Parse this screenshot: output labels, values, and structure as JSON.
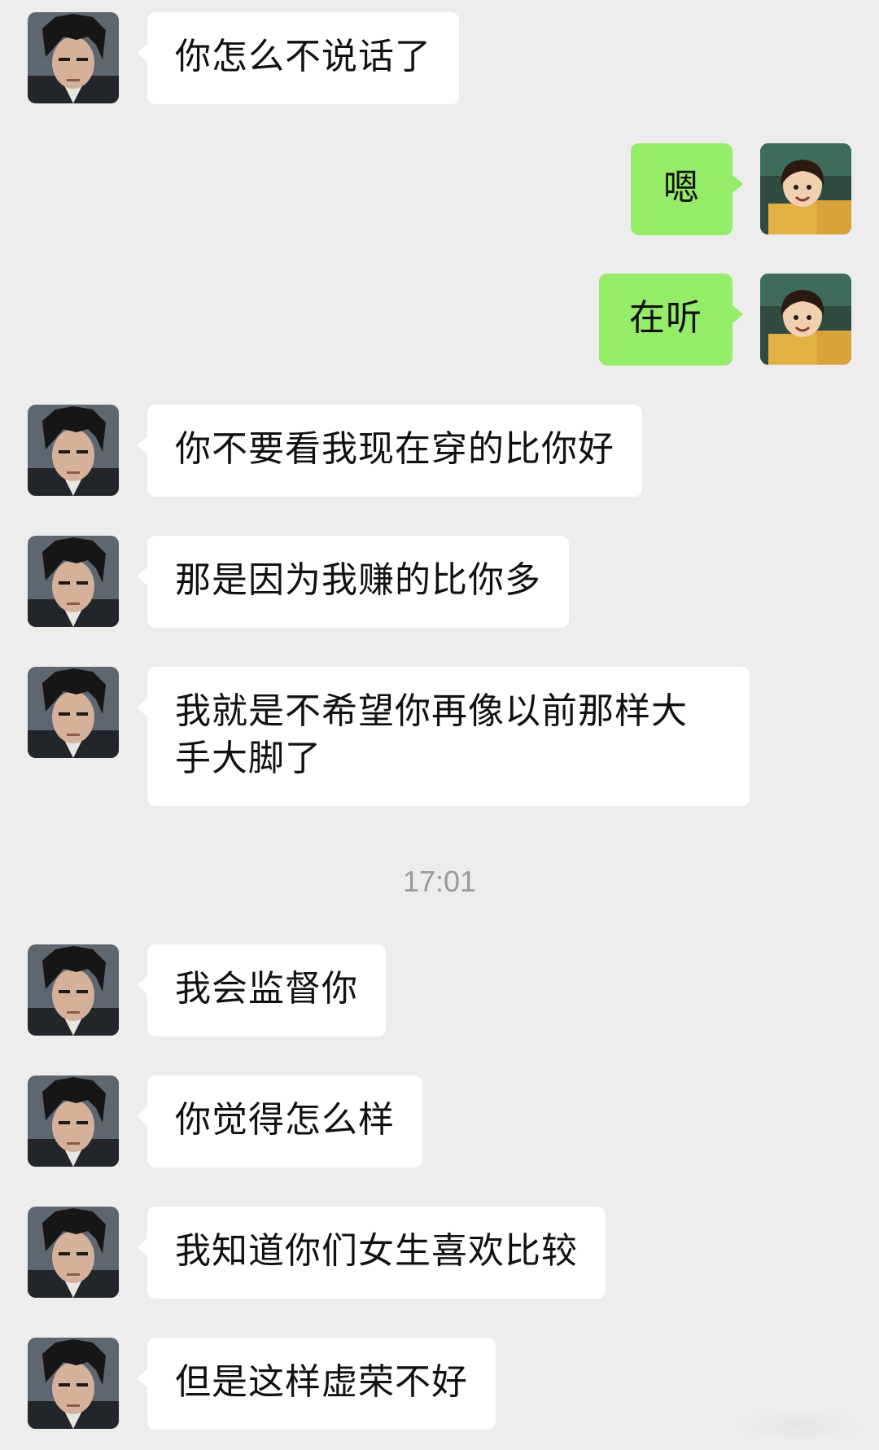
{
  "conversation": {
    "timestamp": "17:01",
    "messages": [
      {
        "side": "in",
        "text": "你怎么不说话了",
        "avatar": "dark-haired-man-avatar"
      },
      {
        "side": "out",
        "text": "嗯",
        "avatar": "smiling-girl-avatar"
      },
      {
        "side": "out",
        "text": "在听",
        "avatar": "smiling-girl-avatar"
      },
      {
        "side": "in",
        "text": "你不要看我现在穿的比你好",
        "avatar": "dark-haired-man-avatar"
      },
      {
        "side": "in",
        "text": "那是因为我赚的比你多",
        "avatar": "dark-haired-man-avatar"
      },
      {
        "side": "in",
        "text": "我就是不希望你再像以前那样大手大脚了",
        "avatar": "dark-haired-man-avatar"
      },
      {
        "side": "in",
        "text": "我会监督你",
        "avatar": "dark-haired-man-avatar"
      },
      {
        "side": "in",
        "text": "你觉得怎么样",
        "avatar": "dark-haired-man-avatar"
      },
      {
        "side": "in",
        "text": "我知道你们女生喜欢比较",
        "avatar": "dark-haired-man-avatar"
      },
      {
        "side": "in",
        "text": "但是这样虚荣不好",
        "avatar": "dark-haired-man-avatar"
      }
    ]
  },
  "colors": {
    "background": "#EDEDED",
    "incoming_bubble": "#FFFFFF",
    "outgoing_bubble": "#95EC69",
    "timestamp": "#9A9A9A"
  }
}
